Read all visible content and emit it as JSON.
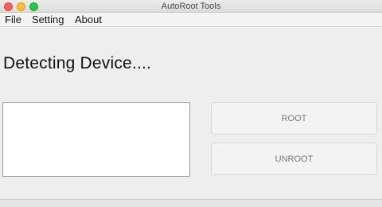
{
  "window": {
    "title": "AutoRoot Tools"
  },
  "menu": {
    "items": [
      "File",
      "Setting",
      "About"
    ]
  },
  "main": {
    "status_text": "Detecting Device....",
    "device_list_value": "",
    "root_button_label": "ROOT",
    "unroot_button_label": "UNROOT"
  },
  "colors": {
    "close_light": "#fe5f57",
    "minimize_light": "#febc2e",
    "maximize_light": "#28c840"
  }
}
